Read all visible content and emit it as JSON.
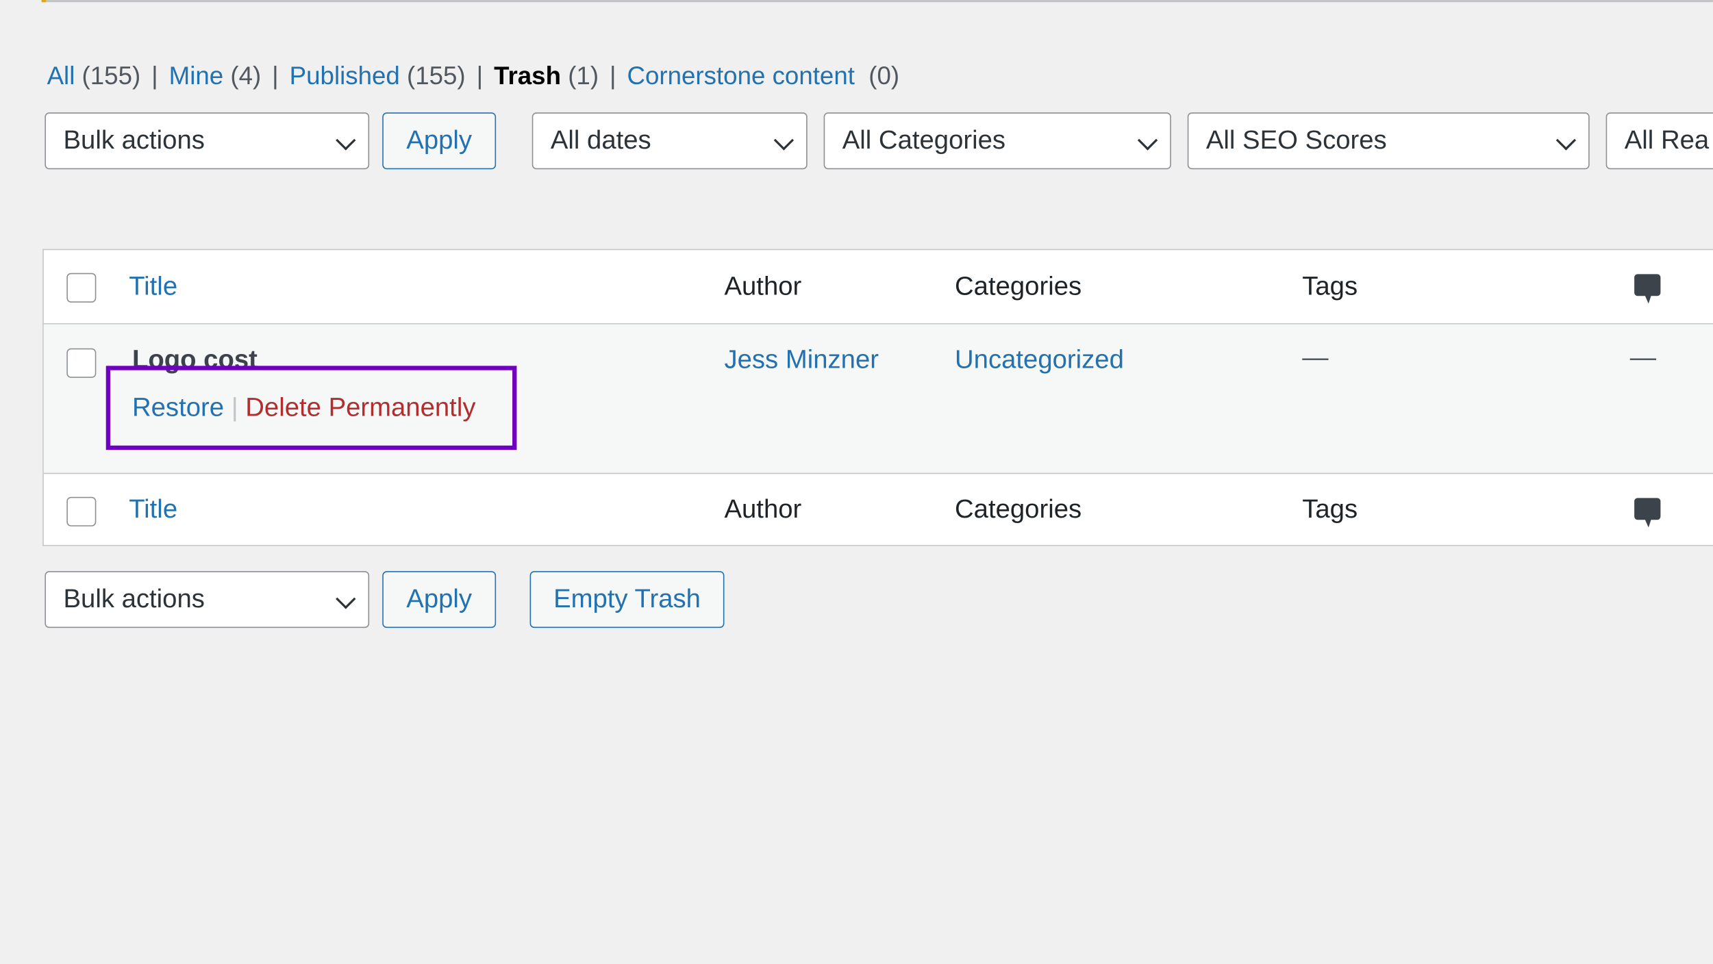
{
  "filters": [
    {
      "label": "All",
      "count": "(155)",
      "current": false
    },
    {
      "label": "Mine",
      "count": "(4)",
      "current": false
    },
    {
      "label": "Published",
      "count": "(155)",
      "current": false
    },
    {
      "label": "Trash",
      "count": "(1)",
      "current": true
    },
    {
      "label": "Cornerstone content",
      "count": " (0)",
      "current": false
    }
  ],
  "top_controls": {
    "bulk_actions": "Bulk actions",
    "apply": "Apply",
    "dates": "All dates",
    "categories": "All Categories",
    "seo": "All SEO Scores",
    "readability": "All Rea"
  },
  "table": {
    "headers": {
      "title": "Title",
      "author": "Author",
      "categories": "Categories",
      "tags": "Tags",
      "comments_icon": "comment-icon"
    },
    "rows": [
      {
        "title": "Logo cost",
        "author": "Jess Minzner",
        "categories": "Uncategorized",
        "tags": "—",
        "comments": "—",
        "actions": {
          "restore": "Restore",
          "sep": "|",
          "delete": "Delete Permanently"
        }
      }
    ]
  },
  "bottom_controls": {
    "bulk_actions": "Bulk actions",
    "apply": "Apply",
    "empty_trash": "Empty Trash"
  },
  "colors": {
    "link": "#2271b1",
    "delete": "#b32d2e",
    "highlight": "#6f00c2"
  }
}
